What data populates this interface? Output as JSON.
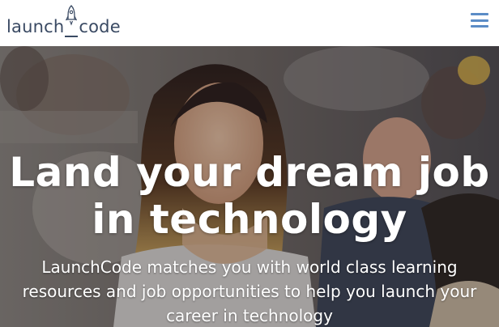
{
  "header": {
    "logo_left": "launch",
    "logo_right": "code",
    "logo_icon": "rocket-icon",
    "menu_icon": "hamburger-menu-icon"
  },
  "hero": {
    "headline_line1": "Land your dream job",
    "headline_line2": "in technology",
    "subtext_line1": "LaunchCode matches you with world class learning",
    "subtext_line2": "resources and job opportunities to help you launch your",
    "subtext_line3": "career in technology"
  },
  "colors": {
    "logo_text": "#3a4a63",
    "menu_icon": "#5b8cc6",
    "hero_text": "#ffffff"
  }
}
